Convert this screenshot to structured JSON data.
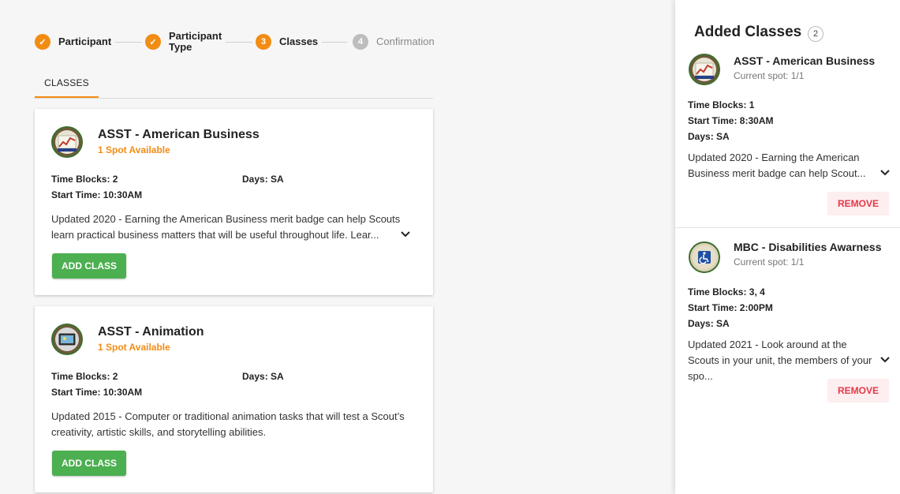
{
  "stepper": {
    "steps": [
      {
        "label": "Participant",
        "state": "done",
        "marker": "✓"
      },
      {
        "label": "Participant\nType",
        "state": "done",
        "marker": "✓"
      },
      {
        "label": "Classes",
        "state": "active",
        "marker": "3"
      },
      {
        "label": "Confirmation",
        "state": "todo",
        "marker": "4"
      }
    ]
  },
  "tabs": [
    {
      "label": "CLASSES",
      "active": true
    }
  ],
  "classes": [
    {
      "title": "ASST - American Business",
      "availability": "1 Spot Available",
      "time_blocks": "Time Blocks: 2",
      "days": "Days: SA",
      "start_time": "Start Time: 10:30AM",
      "description": "Updated 2020 - Earning the American Business merit badge can help Scouts learn practical business matters that will be useful throughout life. Lear...",
      "button": "ADD CLASS",
      "icon": "business-chart-badge-icon"
    },
    {
      "title": "ASST - Animation",
      "availability": "1 Spot Available",
      "time_blocks": "Time Blocks: 2",
      "days": "Days: SA",
      "start_time": "Start Time: 10:30AM",
      "description": "Updated 2015 - Computer or traditional animation tasks that will test a Scout’s creativity, artistic skills, and storytelling abilities.",
      "button": "ADD CLASS",
      "icon": "animation-badge-icon"
    }
  ],
  "added_panel": {
    "title": "Added Classes",
    "count": "2",
    "items": [
      {
        "title": "ASST - American Business",
        "current_spot": "Current spot: 1/1",
        "time_blocks": "Time Blocks: 1",
        "start_time": "Start Time: 8:30AM",
        "days": "Days: SA",
        "description": "Updated 2020 - Earning the American Business merit badge can help Scout...",
        "button": "REMOVE",
        "icon": "business-chart-badge-icon"
      },
      {
        "title": "MBC - Disabilities Awarness",
        "current_spot": "Current spot: 1/1",
        "time_blocks": "Time Blocks: 3, 4",
        "start_time": "Start Time: 2:00PM",
        "days": "Days: SA",
        "description": "Updated 2021 - Look around at the Scouts in your unit, the members of your spo...",
        "button": "REMOVE",
        "icon": "accessibility-badge-icon"
      }
    ]
  },
  "colors": {
    "accent": "#f28c13",
    "add_button": "#4caf50",
    "remove_text": "#e53945",
    "remove_bg": "#fdeef0"
  }
}
